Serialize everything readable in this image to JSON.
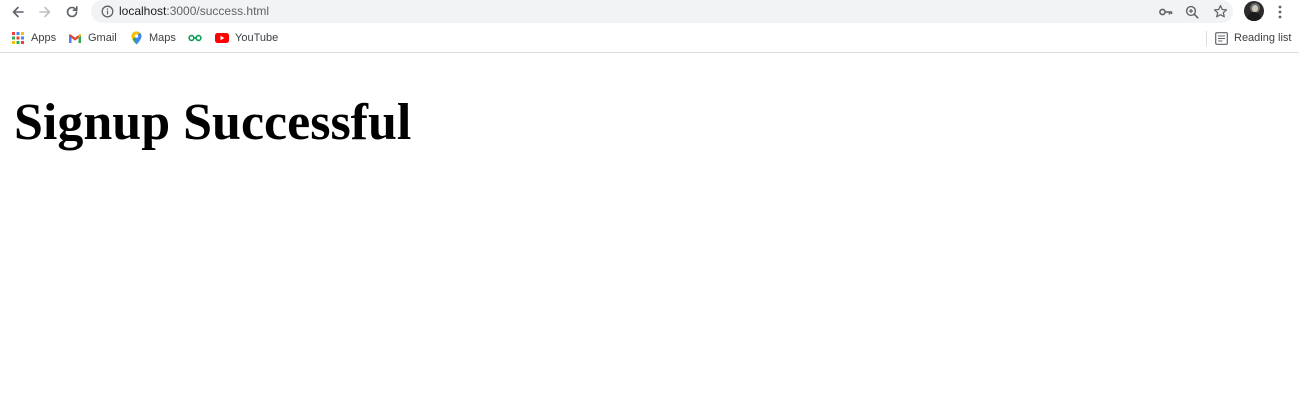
{
  "browser": {
    "url_host": "localhost",
    "url_path": ":3000/success.html",
    "nav": {
      "back_icon": "arrow-left-icon",
      "forward_icon": "arrow-right-icon",
      "reload_icon": "reload-icon"
    },
    "omnibox_icons": [
      "info-icon",
      "key-icon",
      "zoom-icon",
      "star-icon"
    ],
    "menu_icon": "kebab-menu-icon"
  },
  "bookmarks": {
    "items": [
      {
        "label": "Apps",
        "icon": "apps-grid-icon"
      },
      {
        "label": "Gmail",
        "icon": "gmail-icon"
      },
      {
        "label": "Maps",
        "icon": "maps-pin-icon"
      },
      {
        "label": "",
        "icon": "extension-icon"
      },
      {
        "label": "YouTube",
        "icon": "youtube-icon"
      }
    ],
    "reading_list": {
      "label": "Reading list",
      "icon": "reading-list-icon"
    }
  },
  "page": {
    "heading": "Signup Successful"
  },
  "colors": {
    "omnibox_bg": "#f1f3f4",
    "text": "#202124",
    "heading": "#000000",
    "youtube_red": "#ff0000"
  }
}
